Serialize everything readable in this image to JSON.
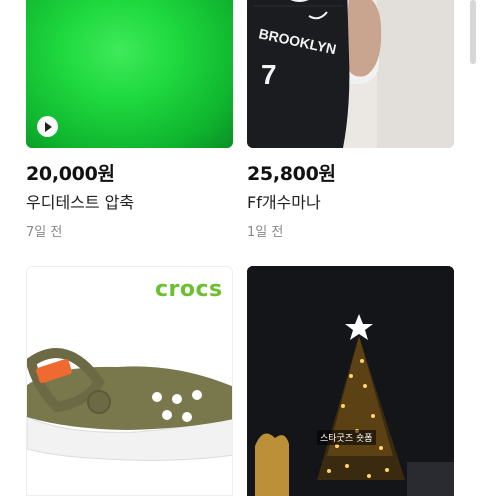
{
  "products": [
    {
      "price": "20,000원",
      "title": "우디테스트 압축",
      "time": "7일 전",
      "media": "video-thumbnail",
      "icon": "play-icon"
    },
    {
      "price": "25,800원",
      "title": "Ff개수마나",
      "time": "1일 전",
      "media": "photo-thumbnail"
    },
    {
      "brand_text": "crocs",
      "media": "photo-thumbnail"
    },
    {
      "caption": "스타굿즈 숏폼",
      "media": "photo-thumbnail"
    }
  ],
  "colors": {
    "accent_green": "#19d640",
    "crocs_green": "#6cbf30",
    "clog_olive": "#79784c",
    "strap_orange": "#ee6a30"
  }
}
